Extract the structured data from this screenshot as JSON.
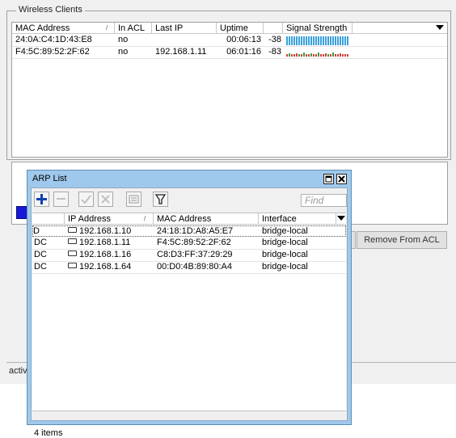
{
  "wireless": {
    "legend": "Wireless Clients",
    "columns": [
      "MAC Address",
      "In ACL",
      "Last IP",
      "Uptime",
      "",
      "Signal Strength"
    ],
    "rows": [
      {
        "mac": "24:0A:C4:1D:43:E8",
        "in_acl": "no",
        "last_ip": "",
        "uptime": "00:06:13",
        "signal": "-38"
      },
      {
        "mac": "F4:5C:89:52:2F:62",
        "in_acl": "no",
        "last_ip": "192.168.1.11",
        "uptime": "06:01:16",
        "signal": "-83"
      }
    ]
  },
  "remove_acl_label": "Remove From ACL",
  "background_status": "activ",
  "arp": {
    "title": "ARP List",
    "find_placeholder": "Find",
    "columns": [
      "",
      "IP Address",
      "MAC Address",
      "Interface"
    ],
    "rows": [
      {
        "flag": "D",
        "ip": "192.168.1.10",
        "mac": "24:18:1D:A8:A5:E7",
        "iface": "bridge-local"
      },
      {
        "flag": "DC",
        "ip": "192.168.1.11",
        "mac": "F4:5C:89:52:2F:62",
        "iface": "bridge-local"
      },
      {
        "flag": "DC",
        "ip": "192.168.1.16",
        "mac": "C8:D3:FF:37:29:29",
        "iface": "bridge-local"
      },
      {
        "flag": "DC",
        "ip": "192.168.1.64",
        "mac": "00:D0:4B:89:80:A4",
        "iface": "bridge-local"
      }
    ],
    "status": "4 items"
  },
  "colors": {
    "signal_good": "#3aa0dc",
    "signal_weak_red": "#d0413a",
    "signal_weak_green": "#3aa040",
    "titlebar": "#9fc9ec"
  },
  "icons": [
    "add-icon",
    "remove-icon",
    "enable-icon",
    "disable-icon",
    "comment-icon",
    "filter-icon",
    "maximize-icon",
    "close-icon"
  ]
}
